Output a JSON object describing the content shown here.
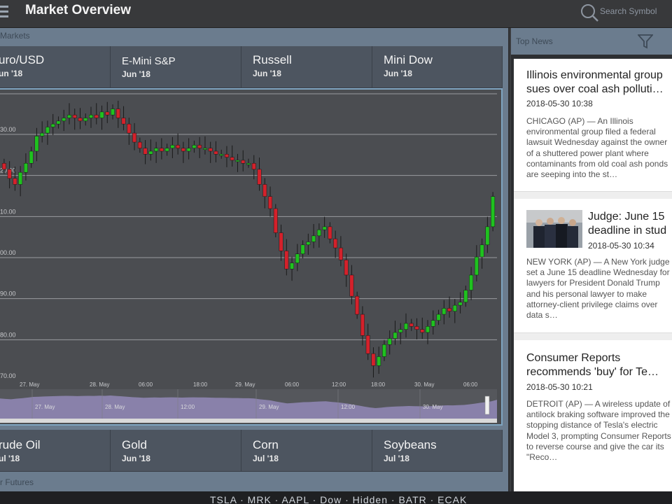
{
  "header": {
    "title": "Market Overview",
    "search_placeholder": "Search Symbol"
  },
  "markets": {
    "section_label": "Markets",
    "futures_label": "r Futures",
    "top_tiles": [
      {
        "name": "uro/USD",
        "sub": "un '18"
      },
      {
        "name": "E-Mini S&P",
        "sub": "Jun '18"
      },
      {
        "name": "Russell",
        "sub": "Jun '18"
      },
      {
        "name": "Mini Dow",
        "sub": "Jun '18"
      }
    ],
    "bottom_tiles": [
      {
        "name": "rude Oil",
        "sub": "ul '18"
      },
      {
        "name": "Gold",
        "sub": "Jun '18"
      },
      {
        "name": "Corn",
        "sub": "Jul '18"
      },
      {
        "name": "Soybeans",
        "sub": "Jul '18"
      }
    ]
  },
  "chart_data": {
    "type": "candlestick",
    "y_tick_labels": [
      "30.00",
      "20.00",
      "10.00",
      "00.00",
      "90.00",
      "80.00",
      "70.00"
    ],
    "x_tick_labels": [
      "27. May",
      "28. May",
      "06:00",
      "18:00",
      "29. May",
      "06:00",
      "12:00",
      "18:00",
      "30. May",
      "06:00"
    ],
    "navigator_labels": [
      "27. May",
      "28. May",
      "12:00",
      "29. May",
      "12:00",
      "30. May"
    ],
    "colors": {
      "up": "#1fc21f",
      "down": "#d4212b",
      "background": "#4b4d51",
      "grid": "#9a9ca0",
      "navigator": "#8f86b3"
    },
    "closes": [
      15,
      12,
      10,
      14,
      17,
      21,
      26,
      27,
      29,
      30,
      31,
      32,
      33,
      32,
      31,
      32,
      33,
      32,
      34,
      33,
      35,
      32,
      30,
      27,
      24,
      22,
      20,
      21,
      22,
      21,
      22,
      23,
      22,
      21,
      22,
      23,
      22,
      22,
      21,
      20,
      20,
      19,
      18,
      18,
      17,
      17,
      15,
      10,
      6,
      2,
      -6,
      -12,
      -18,
      -16,
      -13,
      -10,
      -9,
      -7,
      -5,
      -4,
      -8,
      -11,
      -15,
      -20,
      -27,
      -33,
      -40,
      -46,
      -50,
      -47,
      -43,
      -41,
      -39,
      -38,
      -36,
      -37,
      -38,
      -39,
      -37,
      -35,
      -33,
      -31,
      -32,
      -30,
      -29,
      -25,
      -20,
      -14,
      -10,
      -4,
      6
    ],
    "ylim": [
      -55,
      40
    ]
  },
  "news": {
    "header_label": "Top News",
    "items": [
      {
        "title_line1": "Illinois environmental group",
        "title_line2": "sues over coal ash polluti…",
        "date": "2018-05-30 10:38",
        "body": "CHICAGO (AP) — An Illinois environmental group filed a federal lawsuit Wednesday against the owner of a shuttered power plant where contaminants from old coal ash ponds are seeping into the st…"
      },
      {
        "title_line1": "Judge: June 15",
        "title_line2": "deadline in stud",
        "date": "2018-05-30 10:34",
        "body": "NEW YORK (AP) — A New York judge set a June 15 deadline Wednesday for lawyers for President Donald Trump and his personal lawyer to make attorney-client privilege claims over data s…"
      },
      {
        "title_line1": "Consumer Reports",
        "title_line2": "recommends 'buy' for Te…",
        "date": "2018-05-30 10:21",
        "body": "DETROIT (AP) — A wireless update of antilock braking software improved the stopping distance of Tesla's electric Model 3, prompting Consumer Reports to reverse course and give the car its \"Reco…"
      }
    ]
  },
  "bottom": {
    "ticker": "TSLA · MRK · AAPL · Dow · Hidden · BATR · ECAK"
  }
}
